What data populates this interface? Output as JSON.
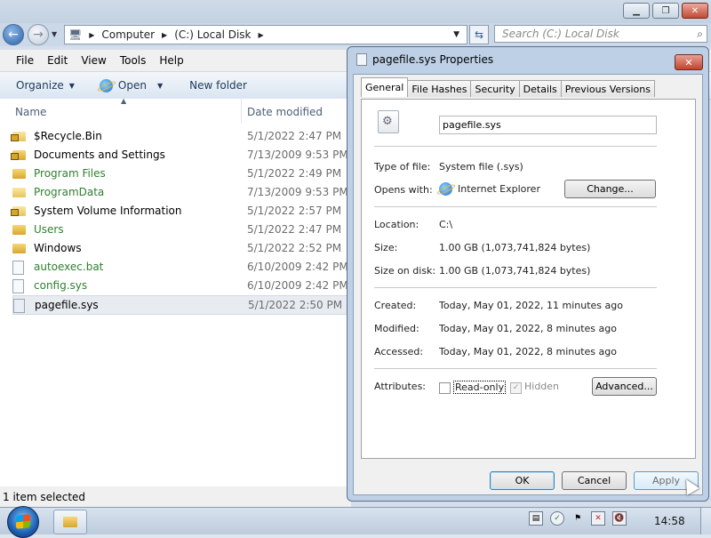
{
  "explorer": {
    "breadcrumb": [
      "Computer",
      "(C:) Local Disk"
    ],
    "search_placeholder": "Search (C:) Local Disk",
    "menu": [
      "File",
      "Edit",
      "View",
      "Tools",
      "Help"
    ],
    "commands": {
      "organize": "Organize",
      "open": "Open",
      "new_folder": "New folder"
    },
    "columns": {
      "name": "Name",
      "date": "Date modified"
    },
    "items": [
      {
        "name": "$Recycle.Bin",
        "date": "5/1/2022 2:47 PM"
      },
      {
        "name": "Documents and Settings",
        "date": "7/13/2009 9:53 PM"
      },
      {
        "name": "Program Files",
        "date": "5/1/2022 2:49 PM"
      },
      {
        "name": "ProgramData",
        "date": "7/13/2009 9:53 PM"
      },
      {
        "name": "System Volume Information",
        "date": "5/1/2022 2:57 PM"
      },
      {
        "name": "Users",
        "date": "5/1/2022 2:47 PM"
      },
      {
        "name": "Windows",
        "date": "5/1/2022 2:52 PM"
      },
      {
        "name": "autoexec.bat",
        "date": "6/10/2009 2:42 PM"
      },
      {
        "name": "config.sys",
        "date": "6/10/2009 2:42 PM"
      },
      {
        "name": "pagefile.sys",
        "date": "5/1/2022 2:50 PM"
      }
    ],
    "status": "1 item selected"
  },
  "dialog": {
    "title": "pagefile.sys Properties",
    "tabs": [
      "General",
      "File Hashes",
      "Security",
      "Details",
      "Previous Versions"
    ],
    "filename": "pagefile.sys",
    "type_label": "Type of file:",
    "type_value": "System file (.sys)",
    "opens_label": "Opens with:",
    "opens_value": "Internet Explorer",
    "change_button": "Change...",
    "location_label": "Location:",
    "location_value": "C:\\",
    "size_label": "Size:",
    "size_value": "1.00 GB (1,073,741,824 bytes)",
    "disk_label": "Size on disk:",
    "disk_value": "1.00 GB (1,073,741,824 bytes)",
    "created_label": "Created:",
    "created_value": "Today, May 01, 2022, 11 minutes ago",
    "modified_label": "Modified:",
    "modified_value": "Today, May 01, 2022, 8 minutes ago",
    "accessed_label": "Accessed:",
    "accessed_value": "Today, May 01, 2022, 8 minutes ago",
    "attributes_label": "Attributes:",
    "readonly_label": "Read-only",
    "hidden_label": "Hidden",
    "advanced_button": "Advanced...",
    "ok_button": "OK",
    "cancel_button": "Cancel",
    "apply_button": "Apply"
  },
  "taskbar": {
    "clock": "14:58"
  }
}
